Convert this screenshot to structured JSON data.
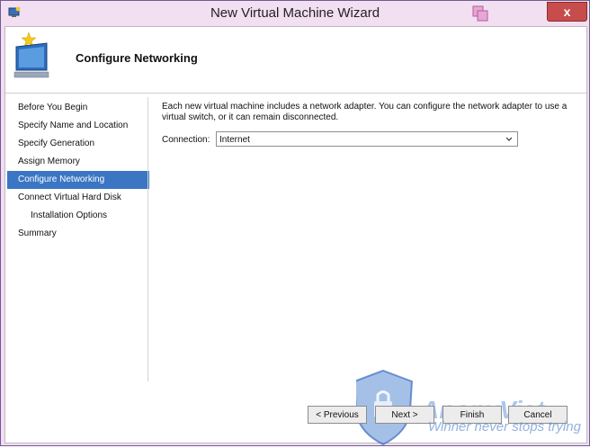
{
  "window": {
    "title": "New Virtual Machine Wizard",
    "close_glyph": "x"
  },
  "page": {
    "heading": "Configure Networking"
  },
  "nav": {
    "items": [
      {
        "label": "Before You Begin"
      },
      {
        "label": "Specify Name and Location"
      },
      {
        "label": "Specify Generation"
      },
      {
        "label": "Assign Memory"
      },
      {
        "label": "Configure Networking",
        "active": true
      },
      {
        "label": "Connect Virtual Hard Disk"
      },
      {
        "label": "Installation Options",
        "sub": true
      },
      {
        "label": "Summary"
      }
    ]
  },
  "content": {
    "description": "Each new virtual machine includes a network adapter. You can configure the network adapter to use a virtual switch, or it can remain disconnected.",
    "connection_label": "Connection:",
    "connection_value": "Internet"
  },
  "buttons": {
    "previous": "< Previous",
    "next": "Next >",
    "finish": "Finish",
    "cancel": "Cancel"
  },
  "watermark": {
    "brand": "AnonyViet",
    "slogan": "Winner never stops trying"
  },
  "colors": {
    "nav_active": "#3a76c4",
    "titlebar": "#f2dff2",
    "close": "#c74c4c"
  }
}
